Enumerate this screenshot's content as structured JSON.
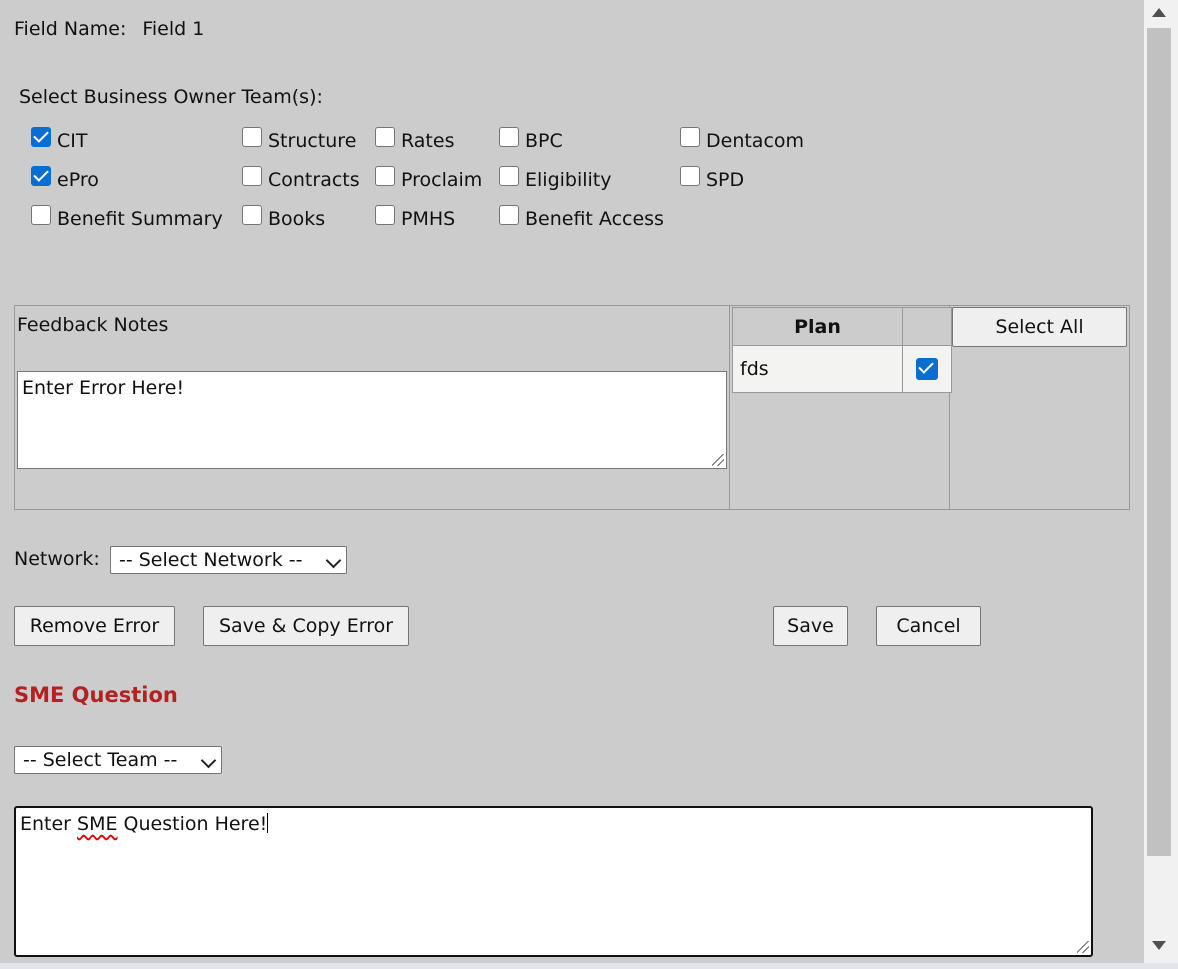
{
  "field": {
    "label": "Field Name:",
    "value": "Field 1"
  },
  "business_owner": {
    "label": "Select Business Owner Team(s):",
    "teams": [
      {
        "name": "CIT",
        "checked": true
      },
      {
        "name": "Structure",
        "checked": false
      },
      {
        "name": "Rates",
        "checked": false
      },
      {
        "name": "BPC",
        "checked": false
      },
      {
        "name": "Dentacom",
        "checked": false
      },
      {
        "name": "ePro",
        "checked": true
      },
      {
        "name": "Contracts",
        "checked": false
      },
      {
        "name": "Proclaim",
        "checked": false
      },
      {
        "name": "Eligibility",
        "checked": false
      },
      {
        "name": "SPD",
        "checked": false
      },
      {
        "name": "Benefit Summary",
        "checked": false
      },
      {
        "name": "Books",
        "checked": false
      },
      {
        "name": "PMHS",
        "checked": false
      },
      {
        "name": "Benefit Access",
        "checked": false
      }
    ]
  },
  "feedback": {
    "label": "Feedback Notes",
    "text": "Enter Error Here!"
  },
  "plan_table": {
    "header": "Plan",
    "rows": [
      {
        "plan": "fds",
        "checked": true
      }
    ]
  },
  "select_all_label": "Select All",
  "network": {
    "label": "Network:",
    "selected": "-- Select Network --"
  },
  "buttons": {
    "remove": "Remove Error",
    "save_copy": "Save & Copy Error",
    "save": "Save",
    "cancel": "Cancel"
  },
  "sme": {
    "heading": "SME Question",
    "team_selected": "-- Select Team --",
    "text_before": "Enter ",
    "text_misspelled": "SME",
    "text_after": " Question Here!"
  },
  "colors": {
    "accent": "#0a6ed1",
    "heading": "#b22222",
    "background": "#cccccc"
  }
}
